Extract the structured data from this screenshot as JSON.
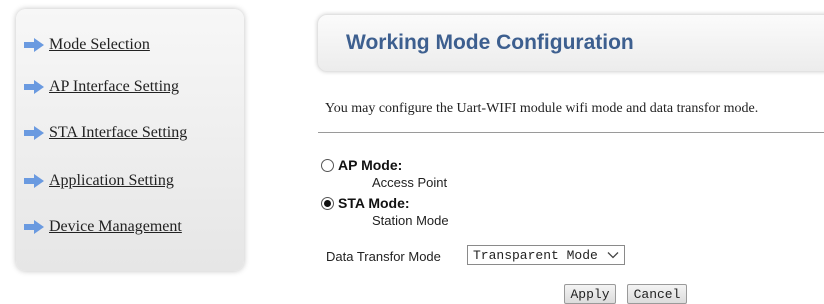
{
  "sidebar": {
    "items": [
      {
        "label": "Mode Selection"
      },
      {
        "label": "AP Interface Setting"
      },
      {
        "label": "STA Interface Setting"
      },
      {
        "label": "Application Setting"
      },
      {
        "label": "Device Management"
      }
    ],
    "arrow_color": "#6a9ae0"
  },
  "header": {
    "title": "Working Mode Configuration"
  },
  "intro": "You may configure the Uart-WIFI module wifi mode and data transfor mode.",
  "modes": {
    "ap": {
      "label": "AP Mode:",
      "desc": "Access Point",
      "selected": false
    },
    "sta": {
      "label": "STA Mode:",
      "desc": "Station Mode",
      "selected": true
    }
  },
  "transfer": {
    "label": "Data Transfor Mode",
    "selected": "Transparent Mode"
  },
  "buttons": {
    "apply": "Apply",
    "cancel": "Cancel"
  }
}
